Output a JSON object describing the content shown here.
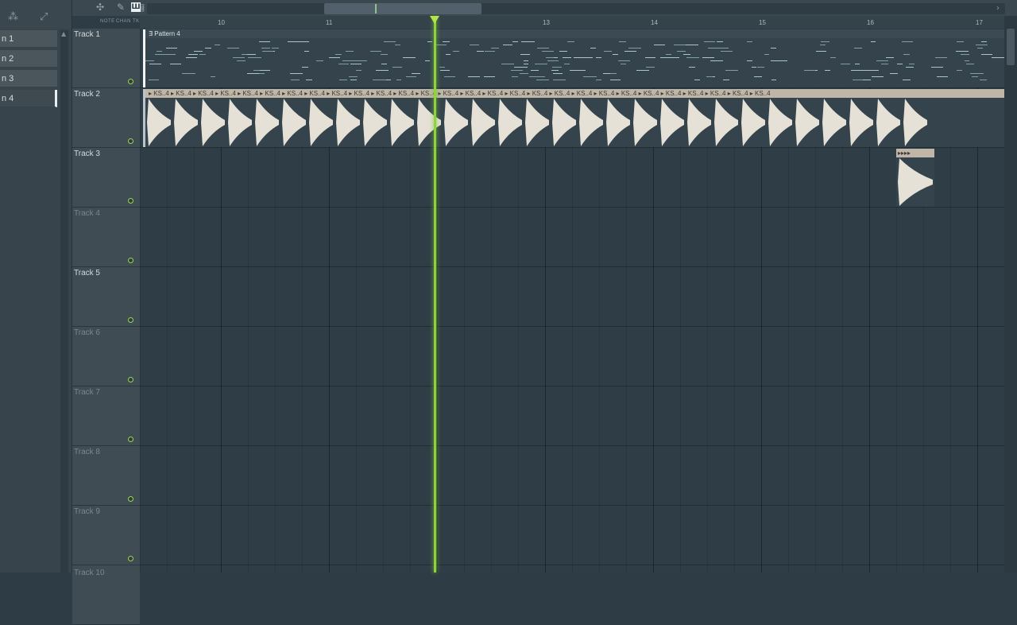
{
  "browser": {
    "patterns": [
      {
        "label": "n 1"
      },
      {
        "label": "n 2"
      },
      {
        "label": "n 3"
      },
      {
        "label": "n 4"
      }
    ]
  },
  "toolbar": {
    "labels": {
      "note": "NOTE",
      "chan": "CHAN",
      "tkl": "TKL"
    }
  },
  "ruler": {
    "bars": [
      "10",
      "11",
      "13",
      "14",
      "15",
      "16",
      "17"
    ]
  },
  "tracks": [
    {
      "name": "Track 1"
    },
    {
      "name": "Track 2"
    },
    {
      "name": "Track 3"
    },
    {
      "name": "Track 4"
    },
    {
      "name": "Track 5"
    },
    {
      "name": "Track 6"
    },
    {
      "name": "Track 7"
    },
    {
      "name": "Track 8"
    },
    {
      "name": "Track 9"
    },
    {
      "name": "Track 10"
    }
  ],
  "clips": {
    "pattern_clip": {
      "label": "Pattern 4"
    },
    "audio_clip": {
      "label": "KS..4"
    }
  },
  "colors": {
    "playhead": "#8fd33c",
    "audio_clip": "#bfb6a7",
    "waveform": "#e6e1d6"
  }
}
